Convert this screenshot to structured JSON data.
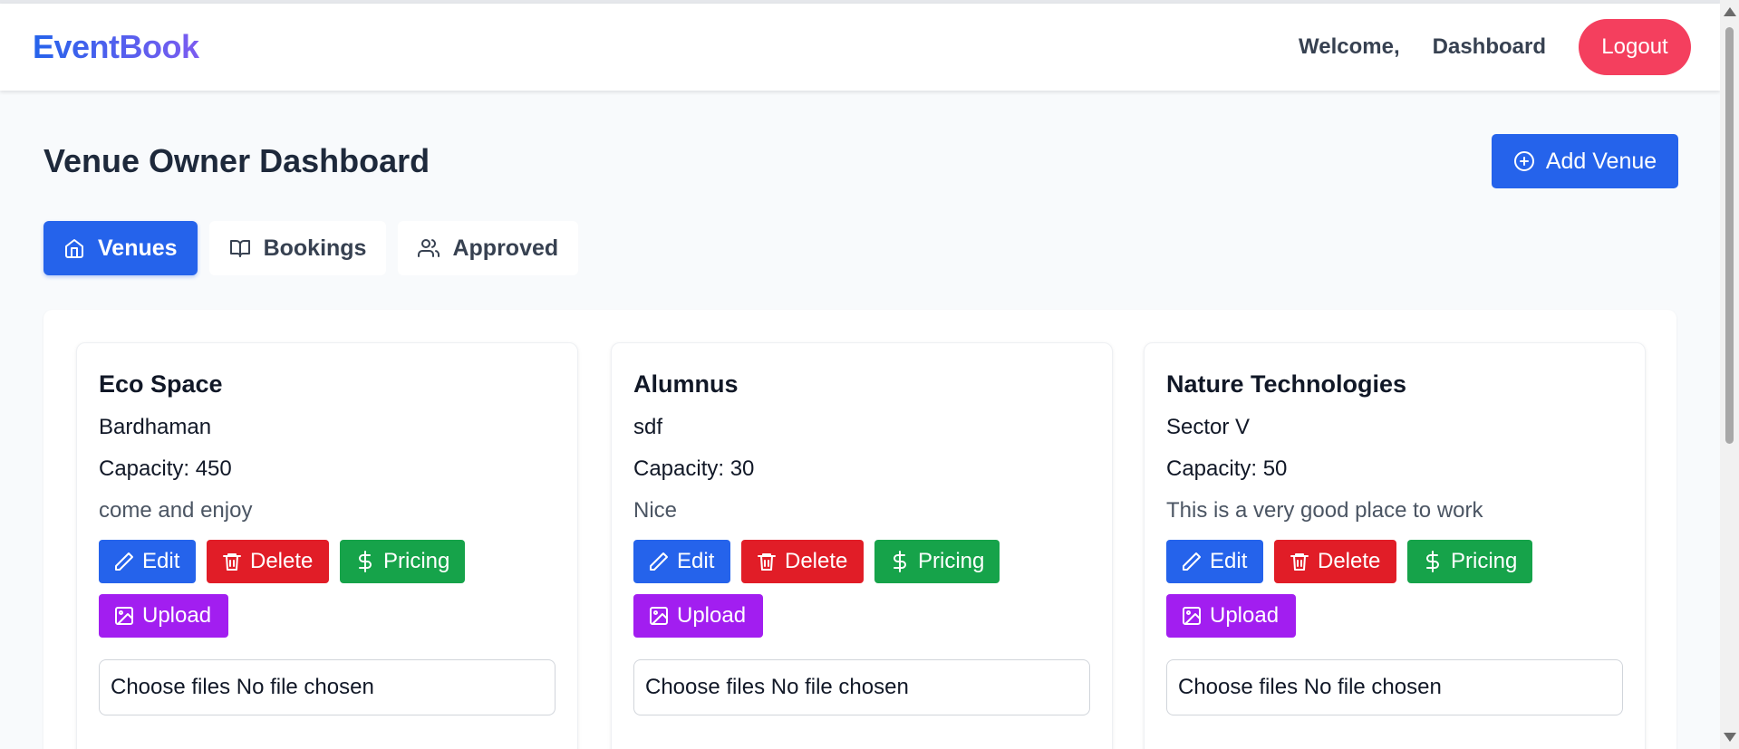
{
  "navbar": {
    "brand": "EventBook",
    "welcome": "Welcome,",
    "dashboard_link": "Dashboard",
    "logout_label": "Logout"
  },
  "page": {
    "title": "Venue Owner Dashboard",
    "add_venue_label": "Add Venue"
  },
  "tabs": [
    {
      "label": "Venues",
      "icon": "home-icon",
      "active": true
    },
    {
      "label": "Bookings",
      "icon": "book-icon",
      "active": false
    },
    {
      "label": "Approved",
      "icon": "users-icon",
      "active": false
    }
  ],
  "card_actions": {
    "edit": "Edit",
    "delete": "Delete",
    "pricing": "Pricing",
    "upload": "Upload",
    "file_input": "Choose files No file chosen"
  },
  "venues": [
    {
      "name": "Eco Space",
      "location": "Bardhaman",
      "capacity": "Capacity: 450",
      "description": "come and enjoy"
    },
    {
      "name": "Alumnus",
      "location": "sdf",
      "capacity": "Capacity: 30",
      "description": "Nice"
    },
    {
      "name": "Nature Technologies",
      "location": "Sector V",
      "capacity": "Capacity: 50",
      "description": "This is a very good place to work"
    }
  ],
  "colors": {
    "primary": "#2563eb",
    "danger": "#e11d27",
    "success": "#16a34a",
    "upload": "#a21ef0",
    "logout": "#f43f5e"
  }
}
